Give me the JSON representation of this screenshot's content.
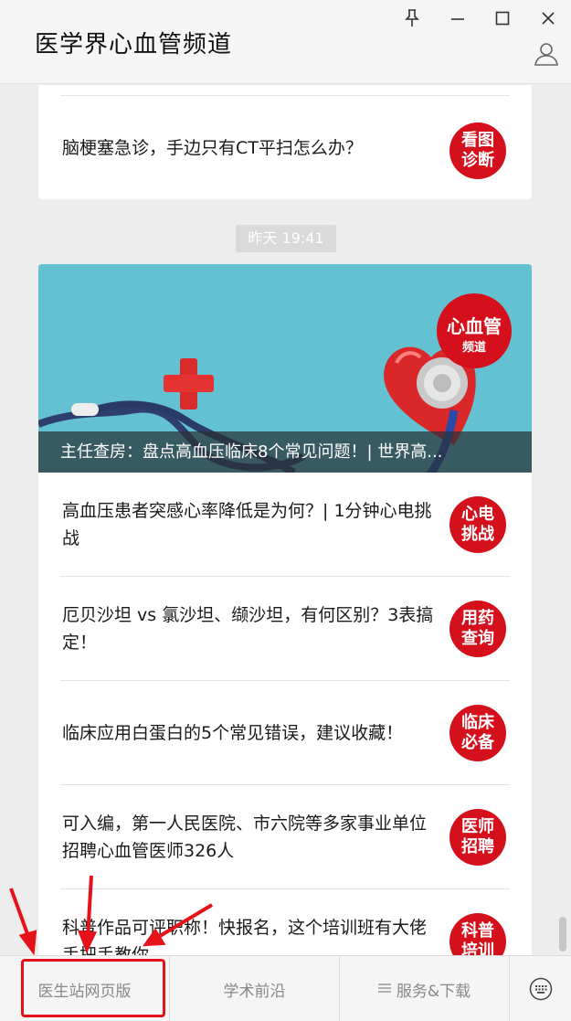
{
  "window": {
    "title": "医学界心血管频道",
    "pin_icon": "pin-icon",
    "minimize_icon": "minimize-icon",
    "maximize_icon": "maximize-icon",
    "close_icon": "close-icon",
    "profile_icon": "user-profile-icon"
  },
  "previous_article": {
    "title": "脑梗塞急诊，手边只有CT平扫怎么办？",
    "badge": "看图诊断"
  },
  "timestamp": "昨天 19:41",
  "hero": {
    "caption": "主任查房：盘点高血压临床8个常见问题！| 世界高...",
    "logo_main": "心血管",
    "logo_sub": "频道"
  },
  "articles": [
    {
      "title": "高血压患者突感心率降低是为何？| 1分钟心电挑战",
      "badge": "心电挑战"
    },
    {
      "title": "厄贝沙坦 vs 氯沙坦、缬沙坦，有何区别？3表搞定！",
      "badge": "用药查询"
    },
    {
      "title": "临床应用白蛋白的5个常见错误，建议收藏！",
      "badge": "临床必备"
    },
    {
      "title": "可入编，第一人民医院、市六院等多家事业单位招聘心血管医师326人",
      "badge": "医师招聘"
    },
    {
      "title": "科普作品可评职称！快报名，这个培训班有大佬手把手教你",
      "badge": "科普培训"
    }
  ],
  "menu": {
    "item1": "医生站网页版",
    "item2": "学术前沿",
    "item3": "服务&下载",
    "item3_icon": "menu-lines-icon",
    "keyboard_icon": "keyboard-icon"
  },
  "colors": {
    "badge_red": "#d3101c",
    "annotation_red": "#e5121a",
    "hero_teal": "#5ab9cb"
  }
}
